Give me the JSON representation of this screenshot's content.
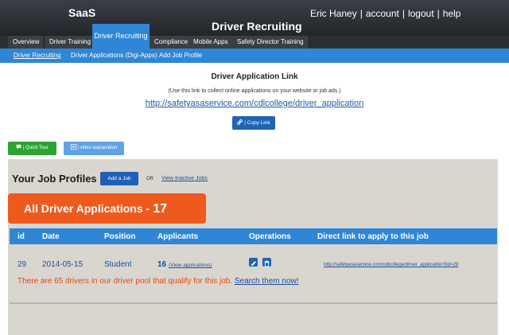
{
  "header": {
    "brand": "SaaS",
    "title": "Driver Recruiting",
    "user_links": [
      "Eric Haney",
      "account",
      "logout",
      "help"
    ]
  },
  "main_tabs": [
    {
      "label": "Overview"
    },
    {
      "label": "Driver Training"
    },
    {
      "label": "Driver Recruiting",
      "active": true
    },
    {
      "label": "Compliance"
    },
    {
      "label": "Mobile Apps"
    },
    {
      "label": "Safety Director Training"
    }
  ],
  "subnav": [
    {
      "label": "Driver Recruiting",
      "active": true
    },
    {
      "label": "Driver Applications (Digi-Apps)"
    },
    {
      "label": "Add Job Profile"
    }
  ],
  "application_link": {
    "title": "Driver Application Link",
    "note": "(Use this link to collect online applications on your website or job ads.)",
    "url": "http://safetyasaservice.com/cdlcollege/driver_application",
    "copy_label": "| Copy Link"
  },
  "buttons": {
    "quick_tour": "| Quick Tour",
    "video": "| video explanation"
  },
  "job_profiles": {
    "title": "Your Job Profiles",
    "add_job": "Add a Job",
    "or": "OR",
    "view_inactive": "View Inactive Jobs"
  },
  "applications_banner": {
    "label": "All Driver Applications -",
    "count": "17"
  },
  "table": {
    "headers": [
      "id",
      "Date",
      "Position",
      "Applicants",
      "Operations",
      "Direct link to apply to this job"
    ],
    "rows": [
      {
        "id": "29",
        "date": "2014-05-15",
        "position": "Student",
        "applicants": "16",
        "view_label": "(View applications)",
        "direct_link": "http://safetyasaservice.com/cdlcollege/driver_application?jid=29"
      }
    ]
  },
  "pool_note": {
    "text": "There are 65 drivers in our driver pool that qualify for this job.",
    "link": "Search them now!"
  },
  "colors": {
    "header_bg": "#2a2e33",
    "accent_blue": "#2f86d6",
    "orange": "#ee5a1e",
    "green": "#2ea332",
    "panel_bg": "#d9d6cf"
  },
  "icons": {
    "copy": "link-icon",
    "quick_tour": "comment-icon",
    "video": "play-icon",
    "edit": "pencil-icon",
    "delete": "trash-icon"
  }
}
